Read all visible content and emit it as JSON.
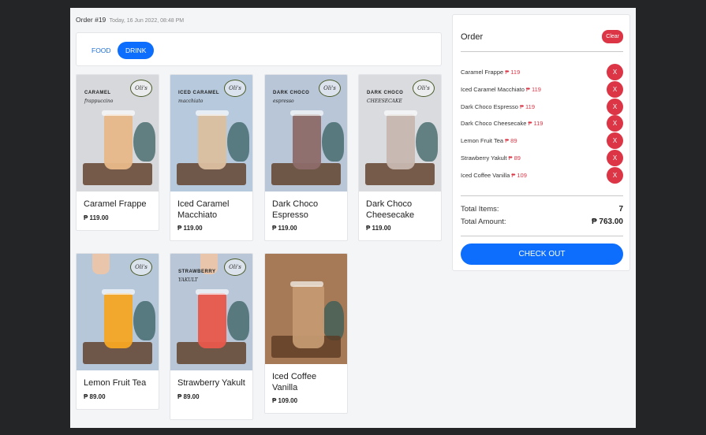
{
  "order": {
    "number": "Order #19",
    "datetime": "Today, 16 Jun 2022, 08:48 PM"
  },
  "tabs": [
    {
      "label": "FOOD",
      "active": false
    },
    {
      "label": "DRINK",
      "active": true
    }
  ],
  "products": [
    {
      "name": "Caramel Frappe",
      "price": "₱ 119.00",
      "drink_color": "#e8b98a",
      "bg": "#d6d8dc",
      "img_label_top": "CARAMEL",
      "img_label_bottom": "frappuccino"
    },
    {
      "name": "Iced Caramel Macchiato",
      "price": "₱ 119.00",
      "drink_color": "#dcc0a0",
      "bg": "#b7c9dd",
      "img_label_top": "ICED CARAMEL",
      "img_label_bottom": "macchiato"
    },
    {
      "name": "Dark Choco Espresso",
      "price": "₱ 119.00",
      "drink_color": "#8e6c6a",
      "bg": "#b8c6d8",
      "img_label_top": "DARK CHOCO",
      "img_label_bottom": "espresso"
    },
    {
      "name": "Dark Choco Cheesecake",
      "price": "₱ 119.00",
      "drink_color": "#c8b8b0",
      "bg": "#d9dbdf",
      "img_label_top": "DARK CHOCO",
      "img_label_bottom": "CHEESECAKE"
    },
    {
      "name": "Lemon Fruit Tea",
      "price": "₱ 89.00",
      "drink_color": "#f5a623",
      "bg": "#b6c7da",
      "img_label_top": "",
      "img_label_bottom": ""
    },
    {
      "name": "Strawberry Yakult",
      "price": "₱ 89.00",
      "drink_color": "#e8594b",
      "bg": "#b8c6d8",
      "img_label_top": "STRAWBERRY",
      "img_label_bottom": "YAKULT"
    },
    {
      "name": "Iced Coffee Vanilla",
      "price": "₱ 109.00",
      "drink_color": "#c49a72",
      "bg": "#a67a56",
      "img_label_top": "",
      "img_label_bottom": ""
    }
  ],
  "logo_text": "Oli's",
  "sidebar": {
    "title": "Order",
    "clear_label": "Clear",
    "items": [
      {
        "name": "Caramel Frappe",
        "price": "₱ 119"
      },
      {
        "name": "Iced Caramel Macchiato",
        "price": "₱ 119"
      },
      {
        "name": "Dark Choco Espresso",
        "price": "₱ 119"
      },
      {
        "name": "Dark Choco Cheesecake",
        "price": "₱ 119"
      },
      {
        "name": "Lemon Fruit Tea",
        "price": "₱ 89"
      },
      {
        "name": "Strawberry Yakult",
        "price": "₱ 89"
      },
      {
        "name": "Iced Coffee Vanilla",
        "price": "₱ 109"
      }
    ],
    "remove_label": "X",
    "total_items_label": "Total Items:",
    "total_items": "7",
    "total_amount_label": "Total Amount:",
    "total_amount": "₱ 763.00",
    "checkout_label": "CHECK OUT"
  },
  "colors": {
    "primary": "#0d6efd",
    "danger": "#dc3545",
    "page_bg": "#232527",
    "app_bg": "#f4f5f7"
  }
}
